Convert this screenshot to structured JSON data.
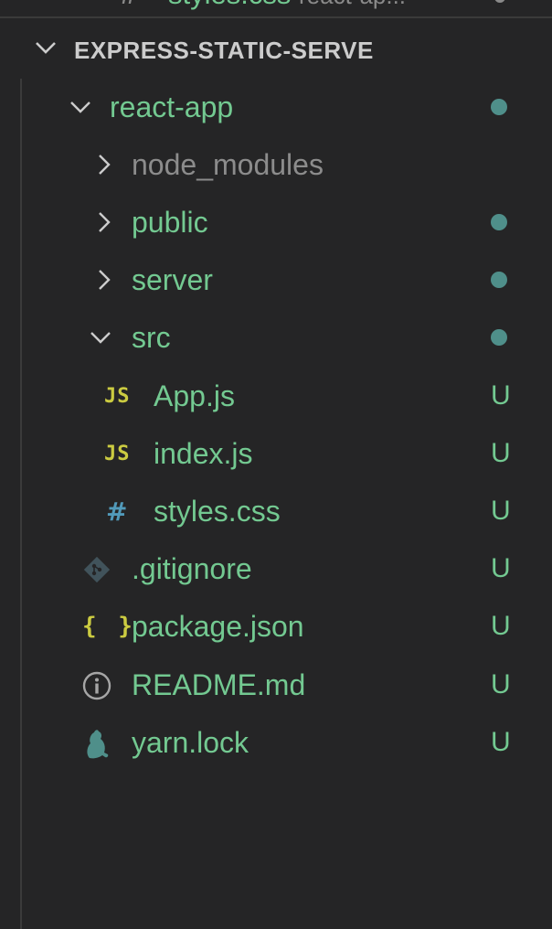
{
  "open_editor_clipped": {
    "icon": "hash-icon",
    "label": "styles.css",
    "path_hint": "react-ap..."
  },
  "section": {
    "title": "EXPRESS-STATIC-SERVE",
    "expanded": true
  },
  "tree": [
    {
      "label": "react-app",
      "type": "folder",
      "expanded": true,
      "status": "dot"
    },
    {
      "label": "node_modules",
      "type": "folder",
      "expanded": false,
      "status": "",
      "ignored": true
    },
    {
      "label": "public",
      "type": "folder",
      "expanded": false,
      "status": "dot"
    },
    {
      "label": "server",
      "type": "folder",
      "expanded": false,
      "status": "dot"
    },
    {
      "label": "src",
      "type": "folder",
      "expanded": true,
      "status": "dot"
    },
    {
      "label": "App.js",
      "type": "file",
      "icon": "js-icon",
      "icon_text": "JS",
      "status": "U"
    },
    {
      "label": "index.js",
      "type": "file",
      "icon": "js-icon",
      "icon_text": "JS",
      "status": "U"
    },
    {
      "label": "styles.css",
      "type": "file",
      "icon": "css-icon",
      "icon_text": "#",
      "status": "U"
    },
    {
      "label": ".gitignore",
      "type": "file",
      "icon": "git-icon",
      "status": "U"
    },
    {
      "label": "package.json",
      "type": "file",
      "icon": "json-icon",
      "icon_text": "{ }",
      "status": "U"
    },
    {
      "label": "README.md",
      "type": "file",
      "icon": "info-icon",
      "status": "U"
    },
    {
      "label": "yarn.lock",
      "type": "file",
      "icon": "yarn-icon",
      "status": "U"
    }
  ],
  "colors": {
    "background": "#252526",
    "untracked_green": "#73c991",
    "ignored_gray": "#8c8c8c",
    "modified_dot": "#4f8f8a",
    "js_yellow": "#cbcb41",
    "css_blue": "#519aba"
  }
}
